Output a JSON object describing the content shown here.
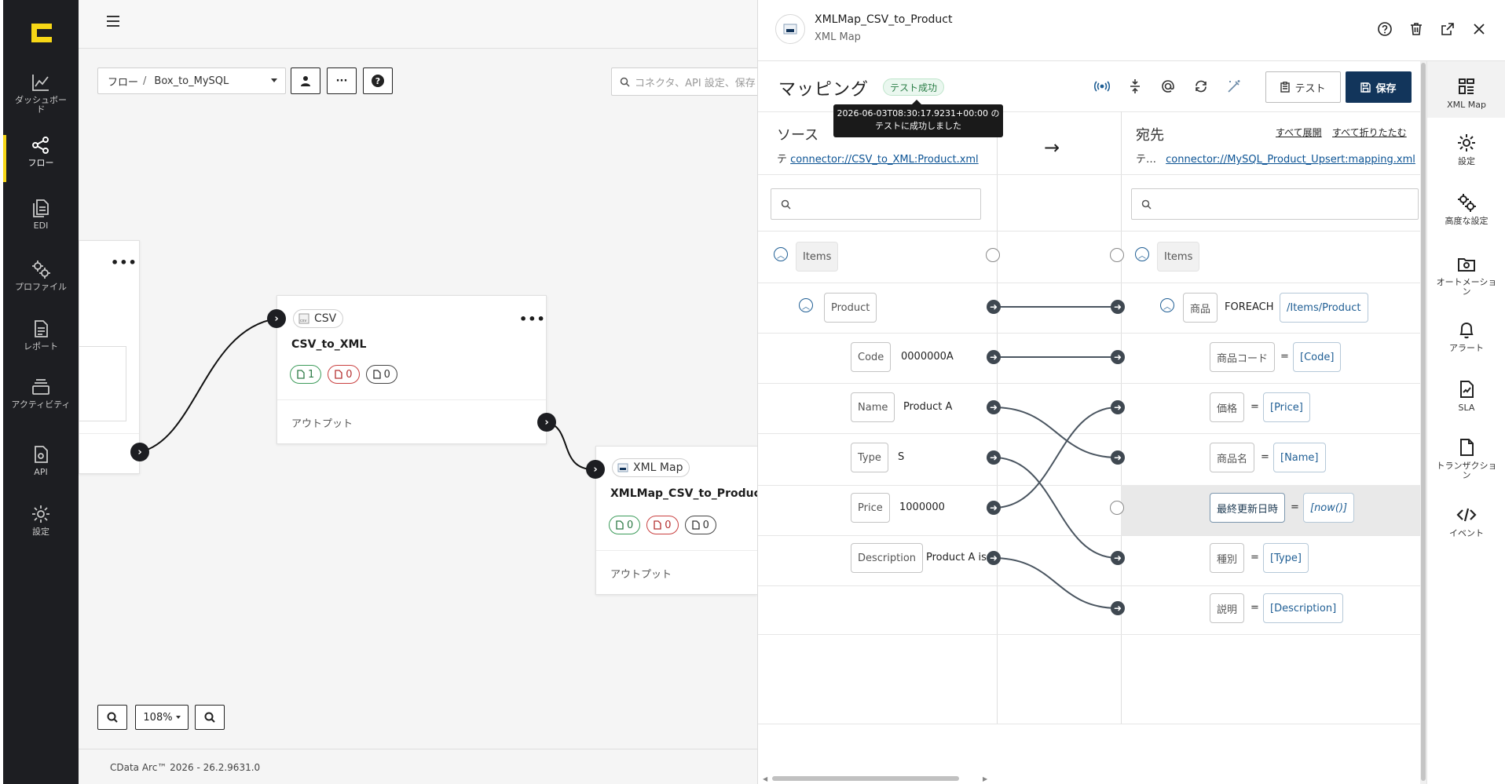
{
  "leftnav": {
    "items": [
      {
        "label": "ダッシュボード",
        "icon": "chart-icon"
      },
      {
        "label": "フロー",
        "icon": "share-icon"
      },
      {
        "label": "EDI",
        "icon": "documents-icon"
      },
      {
        "label": "プロファイル",
        "icon": "gears-icon"
      },
      {
        "label": "レポート",
        "icon": "report-icon"
      },
      {
        "label": "アクティビティ",
        "icon": "stack-icon"
      },
      {
        "label": "API",
        "icon": "api-icon"
      },
      {
        "label": "設定",
        "icon": "gear-icon"
      }
    ],
    "active": "フロー",
    "accent": "#f7d716"
  },
  "canvas": {
    "breadcrumb_root": "フロー",
    "breadcrumb_sep": "/",
    "breadcrumb_current": "Box_to_MySQL",
    "search_placeholder": "コネクタ、API 設定、保存",
    "more_button": "···",
    "help_button": "?",
    "nodes": {
      "left_partial": {
        "more": "•••"
      },
      "csv": {
        "type": "CSV",
        "title": "CSV_to_XML",
        "more": "•••",
        "counts": {
          "ok": "1",
          "err": "0",
          "neu": "0"
        },
        "output": "アウトプット"
      },
      "xmlmap": {
        "type": "XML Map",
        "title": "XMLMap_CSV_to_Product",
        "counts": {
          "ok": "0",
          "err": "0",
          "neu": "0"
        },
        "output": "アウトプット"
      }
    },
    "zoom": "108%",
    "footer": "CData Arc™ 2026 - 26.2.9631.0"
  },
  "panel": {
    "title": "XMLMap_CSV_to_Product",
    "subtitle": "XML Map",
    "mapping_title": "マッピング",
    "status_badge": "テスト成功",
    "tooltip_line1": "2026-06-03T08:30:17.9231+00:00 の",
    "tooltip_line2": "テストに成功しました",
    "test_label": "テスト",
    "save_label": "保存",
    "source": {
      "heading": "ソース",
      "prefix": "テ",
      "link": "connector://CSV_to_XML:Product.xml"
    },
    "arrow": "→",
    "destination": {
      "heading": "宛先",
      "expand_all": "すべて展開",
      "collapse_all": "すべて折りたたむ",
      "prefix": "テ…",
      "link": "connector://MySQL_Product_Upsert:mapping.xml"
    },
    "source_tree": {
      "root": "Items",
      "child": "Product",
      "fields": [
        {
          "name": "Code",
          "value": "0000000A"
        },
        {
          "name": "Name",
          "value": "Product A"
        },
        {
          "name": "Type",
          "value": "S"
        },
        {
          "name": "Price",
          "value": "1000000"
        },
        {
          "name": "Description",
          "value": "Product A is"
        }
      ]
    },
    "dest_tree": {
      "root": "Items",
      "child": "商品",
      "foreach": "FOREACH",
      "foreach_path": "/Items/Product",
      "fields": [
        {
          "name": "商品コード",
          "eq": "=",
          "expr": "[Code]"
        },
        {
          "name": "価格",
          "eq": "=",
          "expr": "[Price]"
        },
        {
          "name": "商品名",
          "eq": "=",
          "expr": "[Name]"
        },
        {
          "name": "最終更新日時",
          "eq": "=",
          "expr": "[now()]"
        },
        {
          "name": "種別",
          "eq": "=",
          "expr": "[Type]"
        },
        {
          "name": "説明",
          "eq": "=",
          "expr": "[Description]"
        }
      ]
    }
  },
  "rail": {
    "items": [
      {
        "label": "XML Map",
        "icon": "grid-icon"
      },
      {
        "label": "設定",
        "icon": "gear-icon"
      },
      {
        "label": "高度な設定",
        "icon": "gears-icon"
      },
      {
        "label": "オートメーション",
        "icon": "automation-icon"
      },
      {
        "label": "アラート",
        "icon": "bell-icon"
      },
      {
        "label": "SLA",
        "icon": "sla-icon"
      },
      {
        "label": "トランザクション",
        "icon": "document-icon"
      },
      {
        "label": "イベント",
        "icon": "code-icon"
      }
    ]
  },
  "colors": {
    "nav_bg": "#1d1e22",
    "save_bg": "#12355b",
    "link": "#0b5394",
    "success": "#2a7d46"
  }
}
